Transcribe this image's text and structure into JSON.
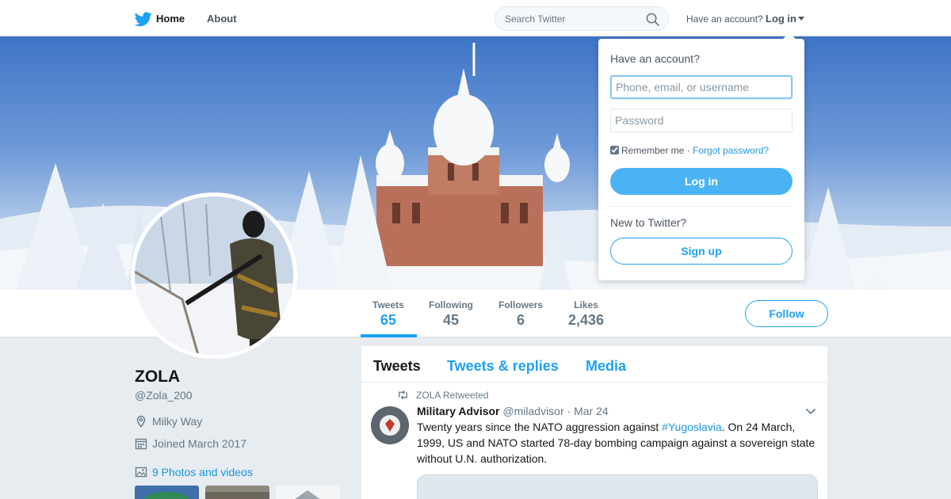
{
  "nav": {
    "home_label": "Home",
    "about_label": "About",
    "search_placeholder": "Search Twitter",
    "have_account": "Have an account?",
    "login_label": "Log in",
    "brand_color": "#1da1f2"
  },
  "profile": {
    "name": "ZOLA",
    "handle": "@Zola_200",
    "location": "Milky Way",
    "joined": "Joined March 2017",
    "photos_link": "9 Photos and videos",
    "follow_label": "Follow"
  },
  "stats": [
    {
      "label": "Tweets",
      "value": "65"
    },
    {
      "label": "Following",
      "value": "45"
    },
    {
      "label": "Followers",
      "value": "6"
    },
    {
      "label": "Likes",
      "value": "2,436"
    }
  ],
  "timeline": {
    "tabs": [
      "Tweets",
      "Tweets & replies",
      "Media"
    ],
    "tweet": {
      "retweeted_by": "ZOLA Retweeted",
      "author_name": "Military Advisor",
      "author_handle": "@miladvisor",
      "date": "· Mar 24",
      "text_before": "Twenty years since the NATO aggression against ",
      "hashtag": "#Yugoslavia",
      "text_after": ". On 24 March, 1999, US and NATO started 78-day bombing campaign against a sovereign state without U.N. authorization."
    }
  },
  "login_dropdown": {
    "title": "Have an account?",
    "username_placeholder": "Phone, email, or username",
    "password_placeholder": "Password",
    "remember_label": "Remember me",
    "separator": " · ",
    "forgot_label": "Forgot password?",
    "login_button": "Log in",
    "new_prompt": "New to Twitter?",
    "signup_button": "Sign up"
  }
}
